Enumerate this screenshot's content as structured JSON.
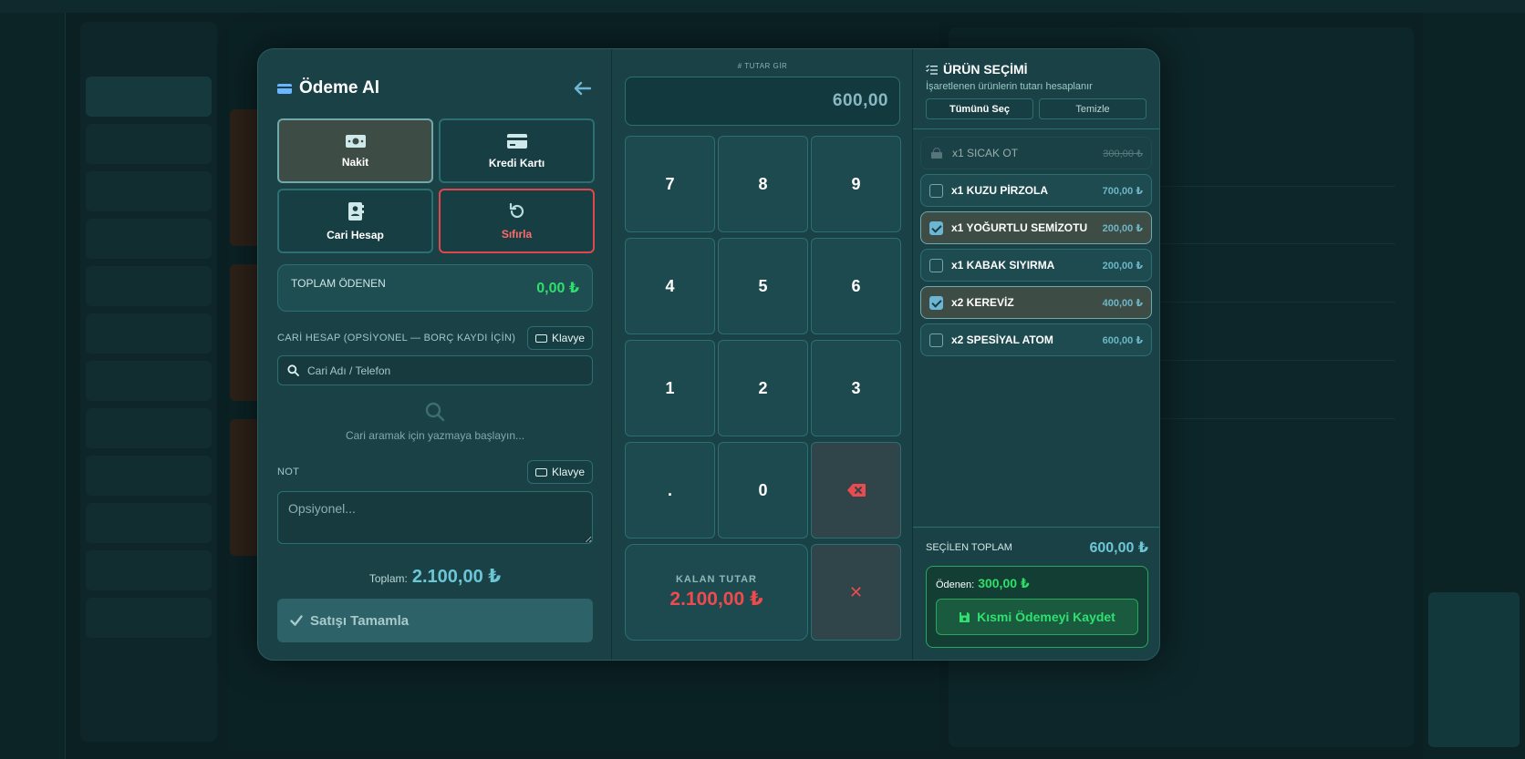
{
  "modal": {
    "title": "Ödeme Al",
    "methods": [
      {
        "label": "Nakit",
        "icon": "cash-icon",
        "active": true
      },
      {
        "label": "Kredi Kartı",
        "icon": "credit-card-icon",
        "active": false
      },
      {
        "label": "Cari Hesap",
        "icon": "address-book-icon",
        "active": false
      },
      {
        "label": "Sıfırla",
        "icon": "reset-icon",
        "active": false
      }
    ],
    "total_paid_label": "TOPLAM ÖDENEN",
    "total_paid_value": "0,00 ₺",
    "account_label": "CARİ HESAP (OPSİYONEL — BORÇ KAYDI İÇİN)",
    "keyboard_label": "Klavye",
    "account_search_placeholder": "Cari Adı / Telefon",
    "empty_search_text": "Cari aramak için yazmaya başlayın...",
    "note_label": "NOT",
    "note_placeholder": "Opsiyonel...",
    "total_label": "Toplam:",
    "total_value": "2.100,00 ₺",
    "complete_button": "Satışı Tamamla"
  },
  "keypad": {
    "amount_label": "# TUTAR GİR",
    "amount_value": "600,00",
    "keys": [
      "7",
      "8",
      "9",
      "4",
      "5",
      "6",
      "1",
      "2",
      "3",
      ".",
      "0"
    ],
    "remaining_label": "KALAN TUTAR",
    "remaining_value": "2.100,00 ₺",
    "clear_symbol": "✕"
  },
  "products": {
    "title": "ÜRÜN SEÇİMİ",
    "subtitle": "İşaretlenen ürünlerin tutarı hesaplanır",
    "select_all": "Tümünü Seç",
    "clear": "Temizle",
    "items": [
      {
        "name": "x1 SICAK OT",
        "price": "300,00 ₺",
        "state": "disabled"
      },
      {
        "name": "x1 KUZU PİRZOLA",
        "price": "700,00 ₺",
        "state": "unchecked"
      },
      {
        "name": "x1 YOĞURTLU SEMİZOTU",
        "price": "200,00 ₺",
        "state": "checked"
      },
      {
        "name": "x1 KABAK SIYIRMA",
        "price": "200,00 ₺",
        "state": "unchecked"
      },
      {
        "name": "x2 KEREVİZ",
        "price": "400,00 ₺",
        "state": "checked"
      },
      {
        "name": "x2 SPESİYAL ATOM",
        "price": "600,00 ₺",
        "state": "unchecked"
      }
    ],
    "selected_total_label": "SEÇİLEN TOPLAM",
    "selected_total_value": "600,00 ₺",
    "paid_label": "Ödenen:",
    "paid_value": "300,00 ₺",
    "save_partial_button": "Kısmi Ödemeyi Kaydet"
  },
  "colors": {
    "accent": "#6cc6d6",
    "success": "#2ee06a",
    "danger": "#f04a4f",
    "panel": "#1a4246"
  }
}
